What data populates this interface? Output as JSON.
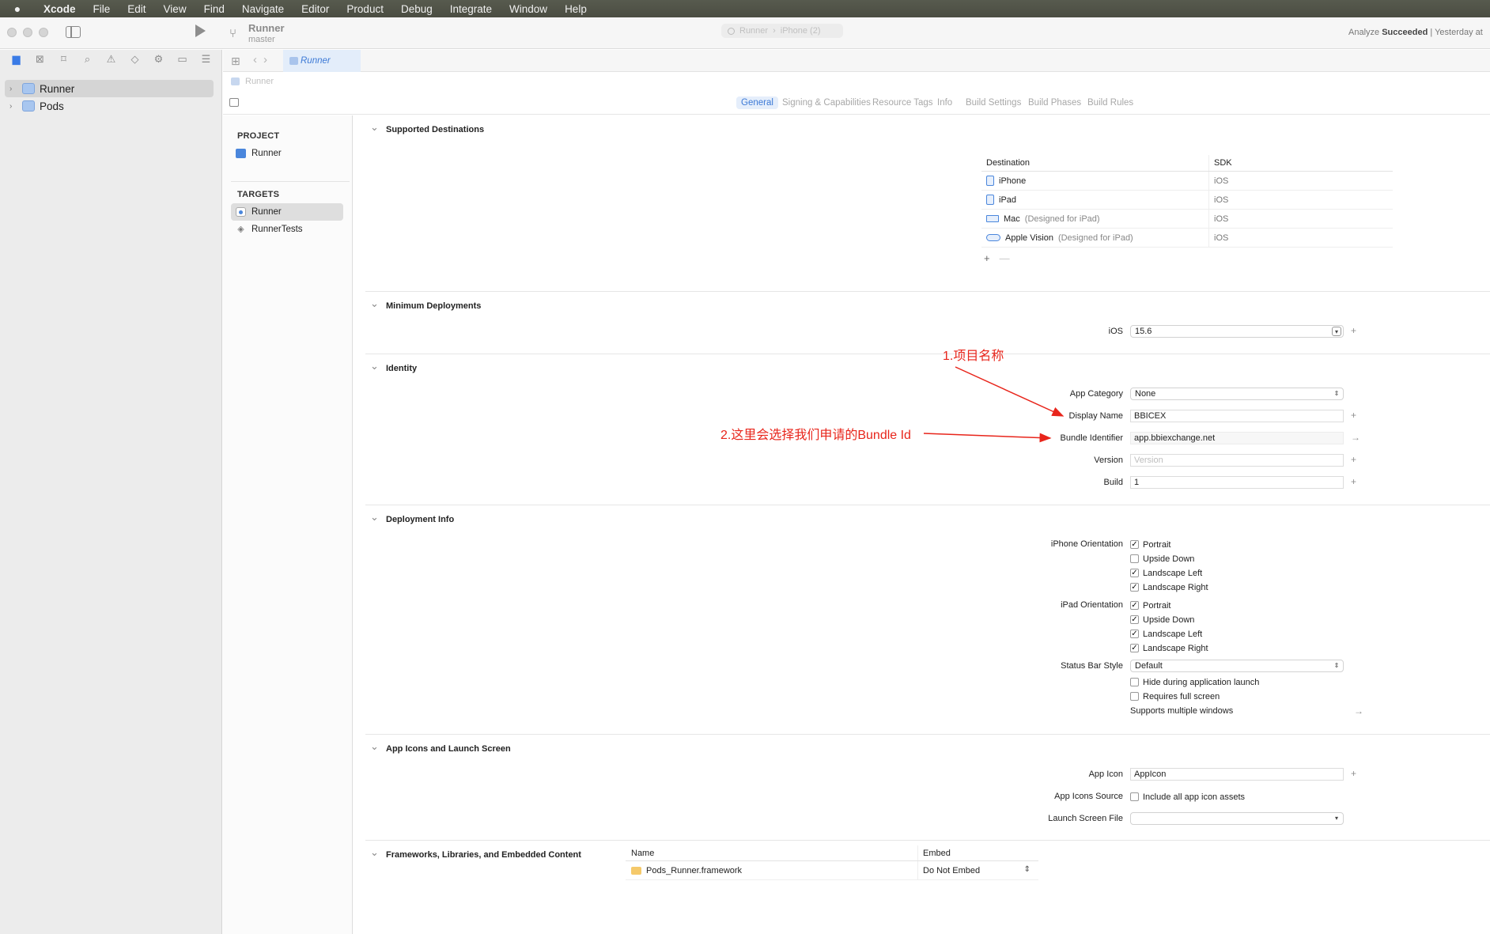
{
  "menubar": {
    "app": "Xcode",
    "items": [
      "File",
      "Edit",
      "View",
      "Find",
      "Navigate",
      "Editor",
      "Product",
      "Debug",
      "Integrate",
      "Window",
      "Help"
    ]
  },
  "toolbar": {
    "project": "Runner",
    "branch": "master",
    "scheme": "Runner",
    "device": "iPhone (2)",
    "status_prefix": "Analyze",
    "status_bold": "Succeeded",
    "status_suffix": "| Yesterday at"
  },
  "navigator": {
    "items": [
      {
        "label": "Runner",
        "selected": true
      },
      {
        "label": "Pods",
        "selected": false
      }
    ]
  },
  "editor": {
    "tab_label": "Runner",
    "breadcrumb": "Runner",
    "settings_tabs": [
      "General",
      "Signing & Capabilities",
      "Resource Tags",
      "Info",
      "Build Settings",
      "Build Phases",
      "Build Rules"
    ],
    "active_tab": "General"
  },
  "targets_pane": {
    "project_heading": "PROJECT",
    "project_item": "Runner",
    "targets_heading": "TARGETS",
    "targets": [
      "Runner",
      "RunnerTests"
    ]
  },
  "sections": {
    "supported_destinations": {
      "title": "Supported Destinations",
      "col_destination": "Destination",
      "col_sdk": "SDK",
      "rows": [
        {
          "name": "iPhone",
          "suffix": "",
          "sdk": "iOS"
        },
        {
          "name": "iPad",
          "suffix": "",
          "sdk": "iOS"
        },
        {
          "name": "Mac",
          "suffix": "(Designed for iPad)",
          "sdk": "iOS"
        },
        {
          "name": "Apple Vision",
          "suffix": "(Designed for iPad)",
          "sdk": "iOS"
        }
      ],
      "add": "+",
      "remove": "—"
    },
    "minimum_deployments": {
      "title": "Minimum Deployments",
      "ios_label": "iOS",
      "ios_value": "15.6"
    },
    "identity": {
      "title": "Identity",
      "app_category_label": "App Category",
      "app_category_value": "None",
      "display_name_label": "Display Name",
      "display_name_value": "BBICEX",
      "bundle_id_label": "Bundle Identifier",
      "bundle_id_value": "app.bbiexchange.net",
      "version_label": "Version",
      "version_placeholder": "Version",
      "build_label": "Build",
      "build_value": "1"
    },
    "deployment_info": {
      "title": "Deployment Info",
      "iphone_orientation_label": "iPhone Orientation",
      "iphone_orientations": [
        {
          "label": "Portrait",
          "checked": true
        },
        {
          "label": "Upside Down",
          "checked": false
        },
        {
          "label": "Landscape Left",
          "checked": true
        },
        {
          "label": "Landscape Right",
          "checked": true
        }
      ],
      "ipad_orientation_label": "iPad Orientation",
      "ipad_orientations": [
        {
          "label": "Portrait",
          "checked": true
        },
        {
          "label": "Upside Down",
          "checked": true
        },
        {
          "label": "Landscape Left",
          "checked": true
        },
        {
          "label": "Landscape Right",
          "checked": true
        }
      ],
      "status_bar_label": "Status Bar Style",
      "status_bar_value": "Default",
      "hide_launch": "Hide during application launch",
      "requires_full_screen": "Requires full screen",
      "multiple_windows": "Supports multiple windows"
    },
    "app_icons": {
      "title": "App Icons and Launch Screen",
      "app_icon_label": "App Icon",
      "app_icon_value": "AppIcon",
      "icons_source_label": "App Icons Source",
      "icons_source_checkbox": "Include all app icon assets",
      "launch_screen_label": "Launch Screen File",
      "launch_screen_value": ""
    },
    "frameworks": {
      "title": "Frameworks, Libraries, and Embedded Content",
      "col_name": "Name",
      "col_embed": "Embed",
      "rows": [
        {
          "name": "Pods_Runner.framework",
          "embed": "Do Not Embed"
        }
      ]
    }
  },
  "annotations": {
    "one": "1.项目名称",
    "two": "2.这里会选择我们申请的Bundle Id"
  },
  "colors": {
    "accent": "#3d7ad6",
    "annotation": "#e8251b",
    "menubar": "#4f5146"
  }
}
